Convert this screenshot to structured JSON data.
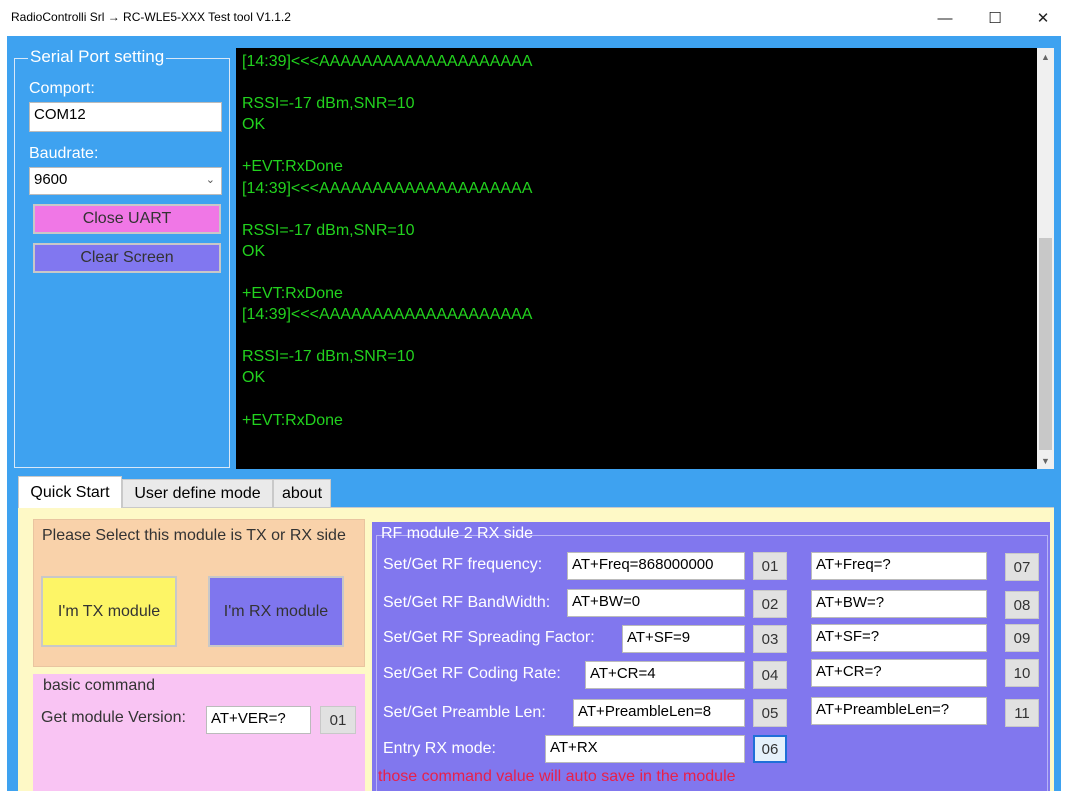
{
  "window": {
    "title": "RadioControlli Srl → RC-WLE5-XXX Test tool V1.1.2",
    "minimize_glyph": "—",
    "maximize_glyph": "☐",
    "close_glyph": "✕"
  },
  "serial": {
    "group_title": "Serial Port setting",
    "comport_label": "Comport:",
    "comport_value": "COM12",
    "baudrate_label": "Baudrate:",
    "baudrate_value": "9600",
    "close_uart_label": "Close UART",
    "clear_screen_label": "Clear Screen"
  },
  "terminal": {
    "lines": [
      "[14:39]<<<AAAAAAAAAAAAAAAAAAAA",
      "",
      "RSSI=-17 dBm,SNR=10",
      "OK",
      "",
      "+EVT:RxDone",
      "[14:39]<<<AAAAAAAAAAAAAAAAAAAA",
      "",
      "RSSI=-17 dBm,SNR=10",
      "OK",
      "",
      "+EVT:RxDone",
      "[14:39]<<<AAAAAAAAAAAAAAAAAAAA",
      "",
      "RSSI=-17 dBm,SNR=10",
      "OK",
      "",
      "+EVT:RxDone"
    ]
  },
  "tabs": [
    {
      "label": "Quick Start",
      "active": true
    },
    {
      "label": "User define mode",
      "active": false
    },
    {
      "label": "about",
      "active": false
    }
  ],
  "txrx": {
    "title": "Please Select this module is TX or RX side",
    "tx_label": "I'm TX module",
    "rx_label": "I'm RX module"
  },
  "basic": {
    "title": "basic command",
    "version_label": "Get module Version:",
    "version_value": "AT+VER=?",
    "version_btn": "01"
  },
  "rf": {
    "title": "RF module 2 RX side",
    "rows": [
      {
        "label": "Set/Get RF frequency:",
        "set_value": "AT+Freq=868000000",
        "set_btn": "01",
        "get_value": "AT+Freq=?",
        "get_btn": "07"
      },
      {
        "label": "Set/Get RF BandWidth:",
        "set_value": "AT+BW=0",
        "set_btn": "02",
        "get_value": "AT+BW=?",
        "get_btn": "08"
      },
      {
        "label": "Set/Get RF Spreading Factor:",
        "set_value": "AT+SF=9",
        "set_btn": "03",
        "get_value": "AT+SF=?",
        "get_btn": "09"
      },
      {
        "label": "Set/Get RF Coding Rate:",
        "set_value": "AT+CR=4",
        "set_btn": "04",
        "get_value": "AT+CR=?",
        "get_btn": "10"
      },
      {
        "label": "Set/Get Preamble Len:",
        "set_value": "AT+PreambleLen=8",
        "set_btn": "05",
        "get_value": "AT+PreambleLen=?",
        "get_btn": "11"
      }
    ],
    "rx_label": "Entry RX mode:",
    "rx_value": "AT+RX",
    "rx_btn": "06",
    "note": "those command value will auto save in the module"
  },
  "colors": {
    "client_bg": "#3ea2f0",
    "terminal_text": "#22d21e",
    "close_uart": "#f077e6",
    "clear_screen": "#8177f0",
    "tx_button": "#fdf566",
    "rx_button": "#7f76ee",
    "rf_panel": "#8177ee",
    "note_text": "#e8204a"
  }
}
